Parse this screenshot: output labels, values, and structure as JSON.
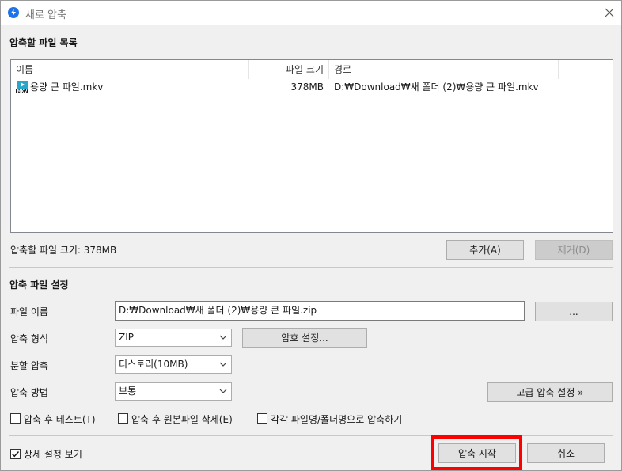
{
  "window": {
    "title": "새로 압축"
  },
  "file_list_section": {
    "heading": "압축할 파일 목록",
    "columns": [
      "이름",
      "파일 크기",
      "경로"
    ],
    "rows": [
      {
        "name": "용량 큰 파일.mkv",
        "size": "378MB",
        "path": "D:₩Download₩새 폴더 (2)₩용량 큰 파일.mkv",
        "icon": "mkv-file-icon"
      }
    ],
    "total_size_label": "압축할 파일 크기: 378MB",
    "add_button": "추가(A)",
    "remove_button": "제거(D)"
  },
  "settings_section": {
    "heading": "압축 파일 설정",
    "filename_label": "파일 이름",
    "filename_value": "D:₩Download₩새 폴더 (2)₩용량 큰 파일.zip",
    "browse_button": "...",
    "format_label": "압축 형식",
    "format_value": "ZIP",
    "password_button": "암호 설정...",
    "split_label": "분할 압축",
    "split_value": "티스토리(10MB)",
    "method_label": "압축 방법",
    "method_value": "보통",
    "advanced_button": "고급 압축 설정 »",
    "options": [
      {
        "label": "압축 후 테스트(T)",
        "checked": false
      },
      {
        "label": "압축 후 원본파일 삭제(E)",
        "checked": false
      },
      {
        "label": "각각 파일명/폴더명으로 압축하기",
        "checked": false
      }
    ]
  },
  "footer": {
    "details_label": "상세 설정 보기",
    "details_checked": true,
    "start_button": "압축 시작",
    "cancel_button": "취소"
  },
  "colors": {
    "accent": "#1e73e8",
    "highlight": "#ff0000"
  }
}
